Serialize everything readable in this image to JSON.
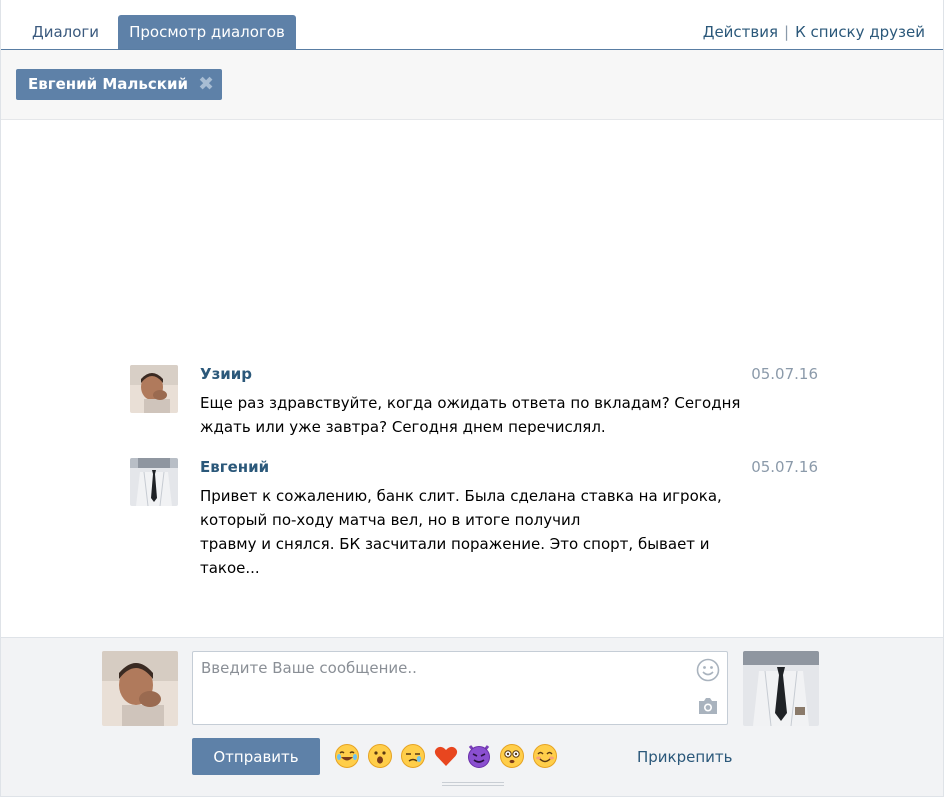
{
  "tabs": {
    "dialogs": "Диалоги",
    "view_dialogs": "Просмотр диалогов"
  },
  "header_actions": {
    "actions": "Действия",
    "separator": "|",
    "to_friends": "К списку друзей"
  },
  "filter": {
    "person": "Евгений Мальский"
  },
  "messages": [
    {
      "author": "Узиир",
      "date": "05.07.16",
      "lines": [
        "Еще раз здравствуйте, когда ожидать ответа по вкладам? Сегодня",
        "ждать или уже завтра? Сегодня днем перечислял."
      ]
    },
    {
      "author": "Евгений",
      "date": "05.07.16",
      "lines": [
        "Привет к сожалению, банк слит. Была сделана ставка на игрока,",
        "который по-ходу матча вел, но в итоге получил",
        "травму и снялся. БК засчитали поражение. Это спорт, бывает и",
        "такое..."
      ]
    }
  ],
  "composer": {
    "placeholder": "Введите Ваше сообщение..",
    "value": "",
    "send_label": "Отправить",
    "attach_label": "Прикрепить",
    "emoji_icons": [
      "crying-laughing-emoji",
      "surprised-emoji",
      "sleepy-emoji",
      "heart-emoji",
      "devil-emoji",
      "dizzy-emoji",
      "blushing-smile-emoji"
    ]
  },
  "colors": {
    "accent": "#5e81a8",
    "link": "#2b587a",
    "date": "#8b9aaa"
  }
}
